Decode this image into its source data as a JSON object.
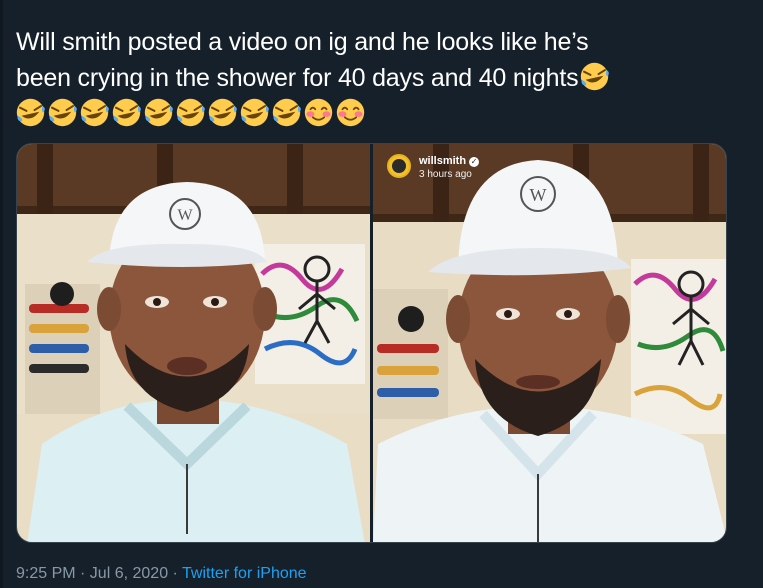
{
  "tweet": {
    "text_line1": "Will smith posted a video on ig and he looks like he’s",
    "text_line2": "been crying in the shower for 40 days and 40 nights",
    "emojis": [
      "rolling-on-floor-laughing",
      "rolling-on-floor-laughing",
      "rolling-on-floor-laughing",
      "rolling-on-floor-laughing",
      "rolling-on-floor-laughing",
      "rolling-on-floor-laughing",
      "rolling-on-floor-laughing",
      "rolling-on-floor-laughing",
      "rolling-on-floor-laughing",
      "rolling-on-floor-laughing",
      "smiling-blushing",
      "smiling-blushing"
    ],
    "timestamp": "9:25 PM · Jul 6, 2020",
    "separator": " · ",
    "source": "Twitter for iPhone"
  },
  "media": {
    "right_overlay": {
      "username": "willsmith",
      "verified_symbol": "✓",
      "time_ago": "3 hours ago"
    },
    "cap_logo": "W"
  },
  "colors": {
    "background": "#15202b",
    "text": "#ffffff",
    "secondary_text": "#8899a6",
    "link": "#1da1f2"
  }
}
